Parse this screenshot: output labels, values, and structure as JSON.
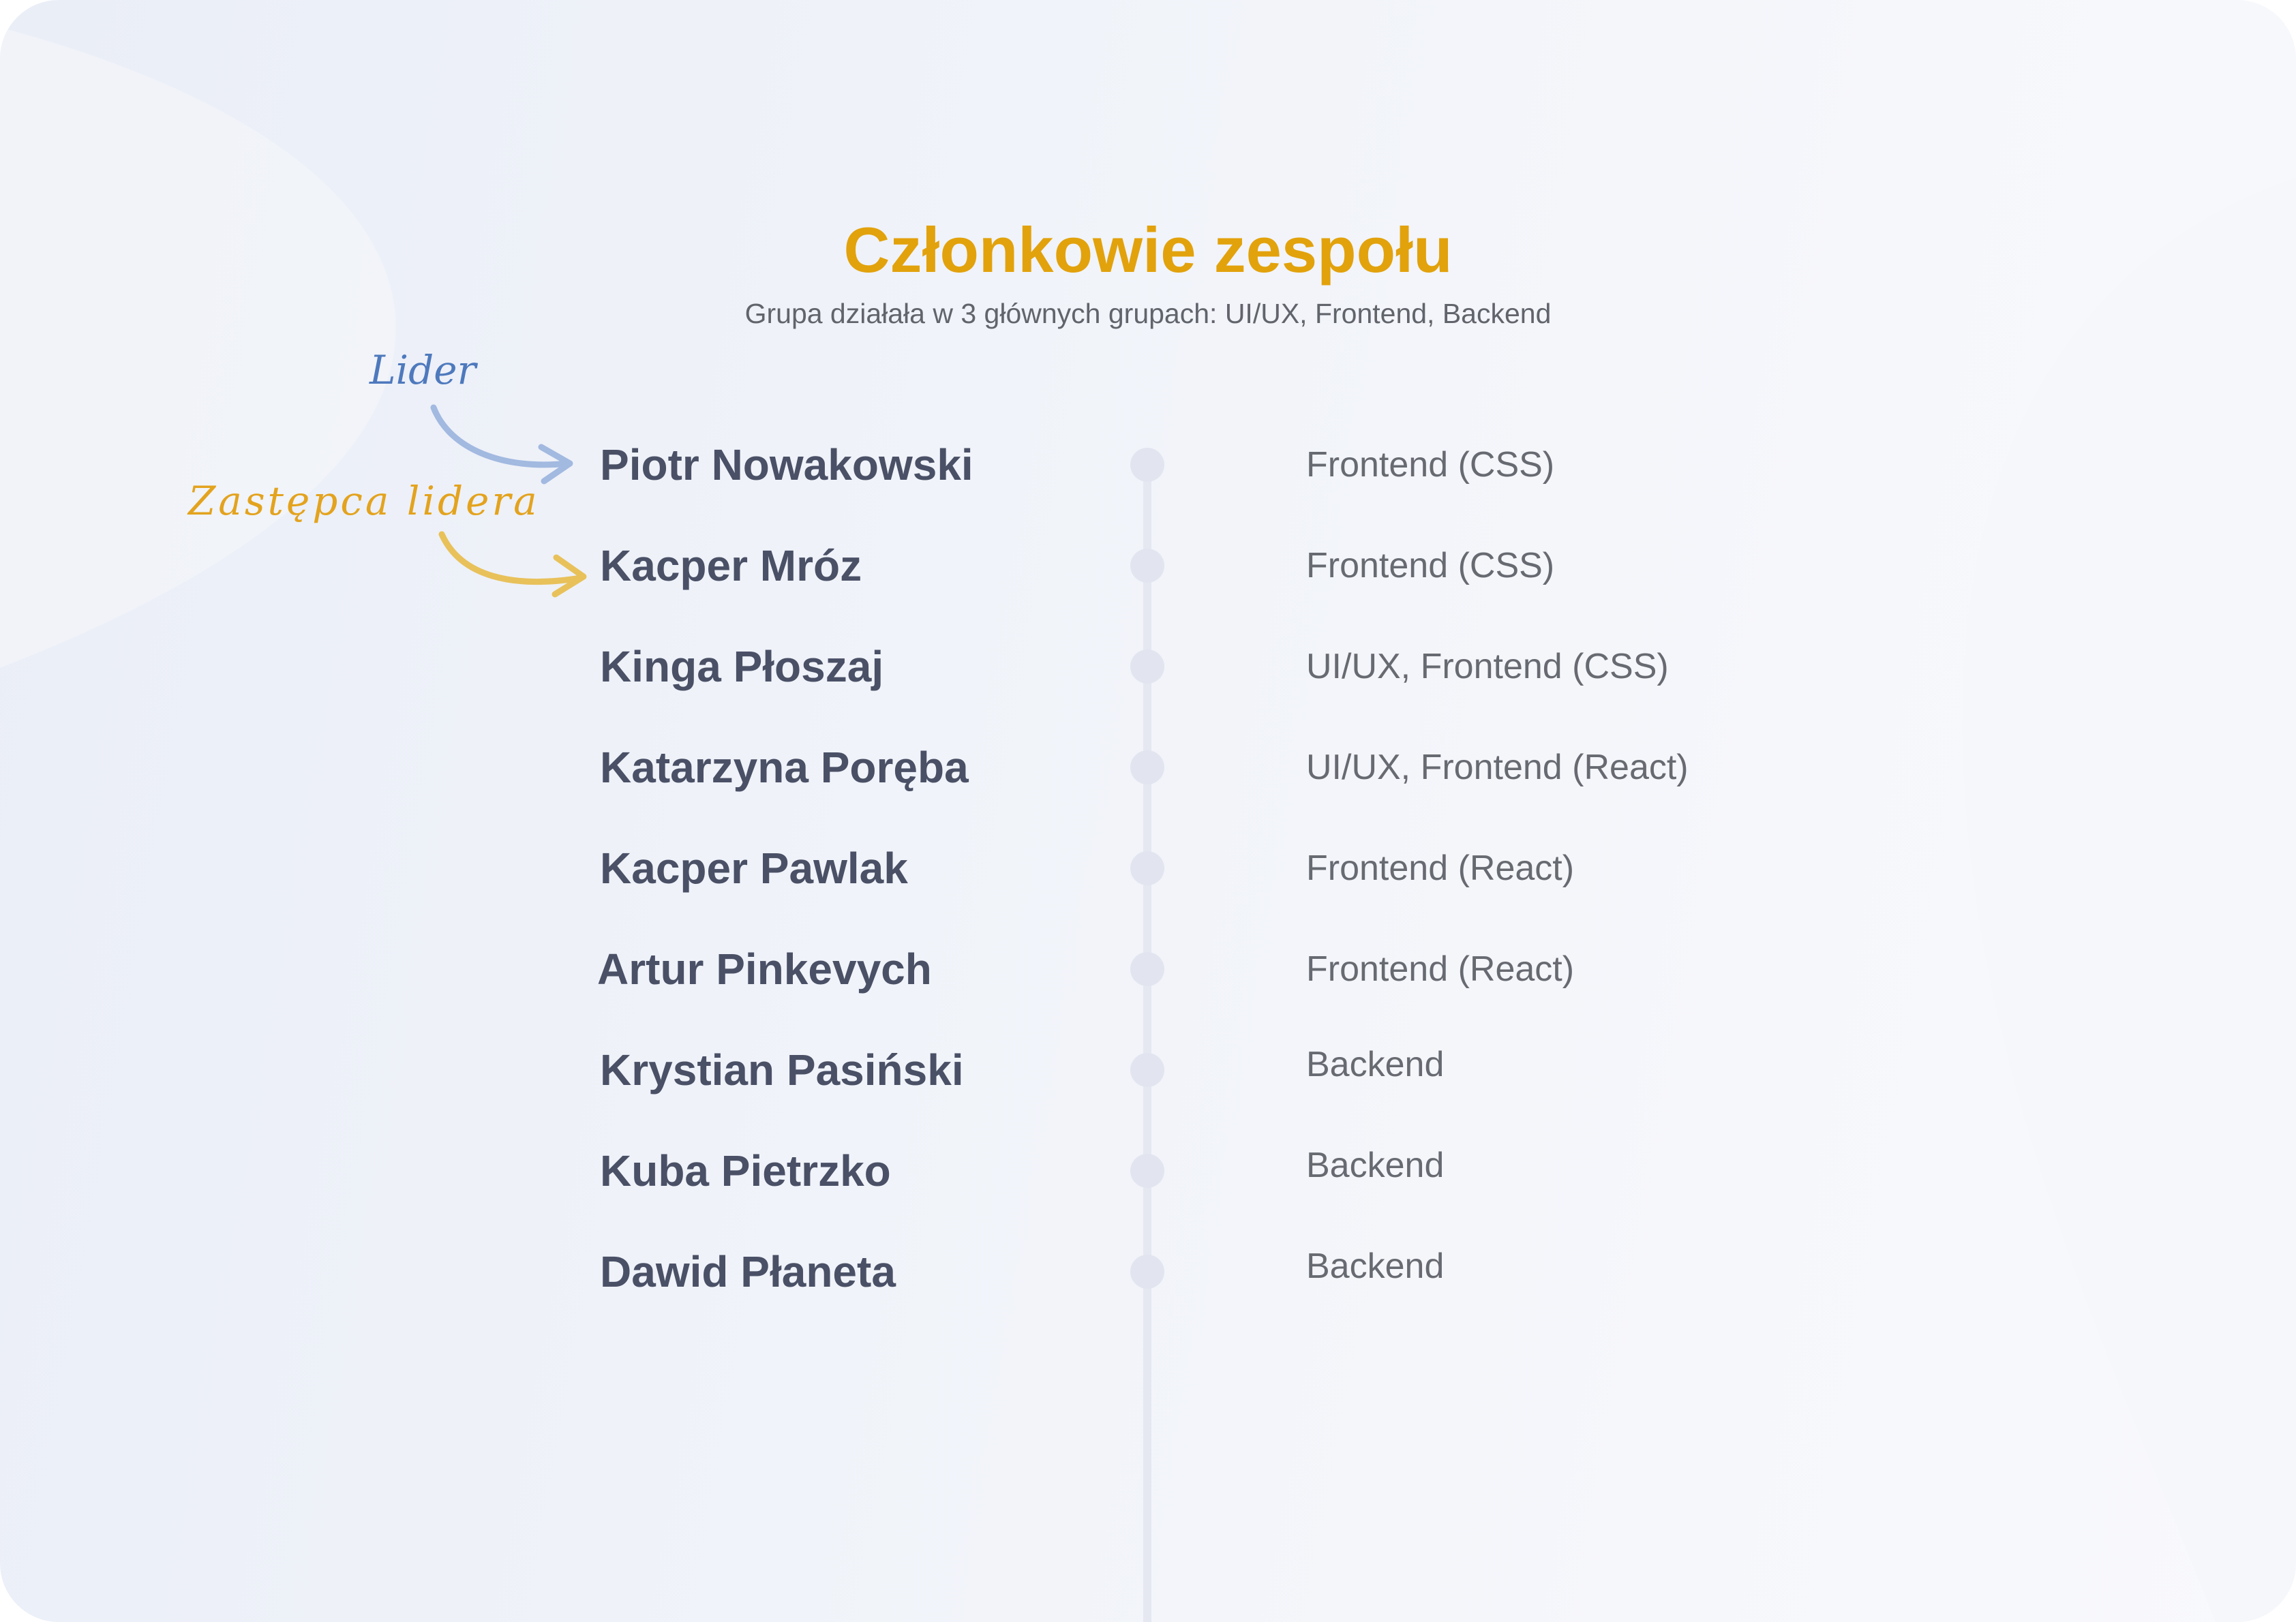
{
  "title": "Członkowie zespołu",
  "subtitle": "Grupa działała w 3 głównych grupach: UI/UX, Frontend, Backend",
  "annotations": {
    "leader": "Lider",
    "deputy": "Zastępca lidera"
  },
  "members": [
    {
      "name": "Piotr Nowakowski",
      "role": "Frontend (CSS)"
    },
    {
      "name": "Kacper Mróz",
      "role": "Frontend (CSS)"
    },
    {
      "name": "Kinga Płoszaj",
      "role": "UI/UX, Frontend (CSS)"
    },
    {
      "name": "Katarzyna Poręba",
      "role": "UI/UX, Frontend (React)"
    },
    {
      "name": "Kacper Pawlak",
      "role": "Frontend (React)"
    },
    {
      "name": "Artur Pinkevych",
      "role": "Frontend (React)"
    },
    {
      "name": "Krystian Pasiński",
      "role": "Backend"
    },
    {
      "name": "Kuba Pietrzko",
      "role": "Backend"
    },
    {
      "name": "Dawid Płaneta",
      "role": "Backend"
    }
  ],
  "colors": {
    "accent": "#e2a20c",
    "leader_note": "#4e79bd",
    "deputy_note": "#e3a31e",
    "name_text": "#4a5066",
    "role_text": "#686a72"
  }
}
